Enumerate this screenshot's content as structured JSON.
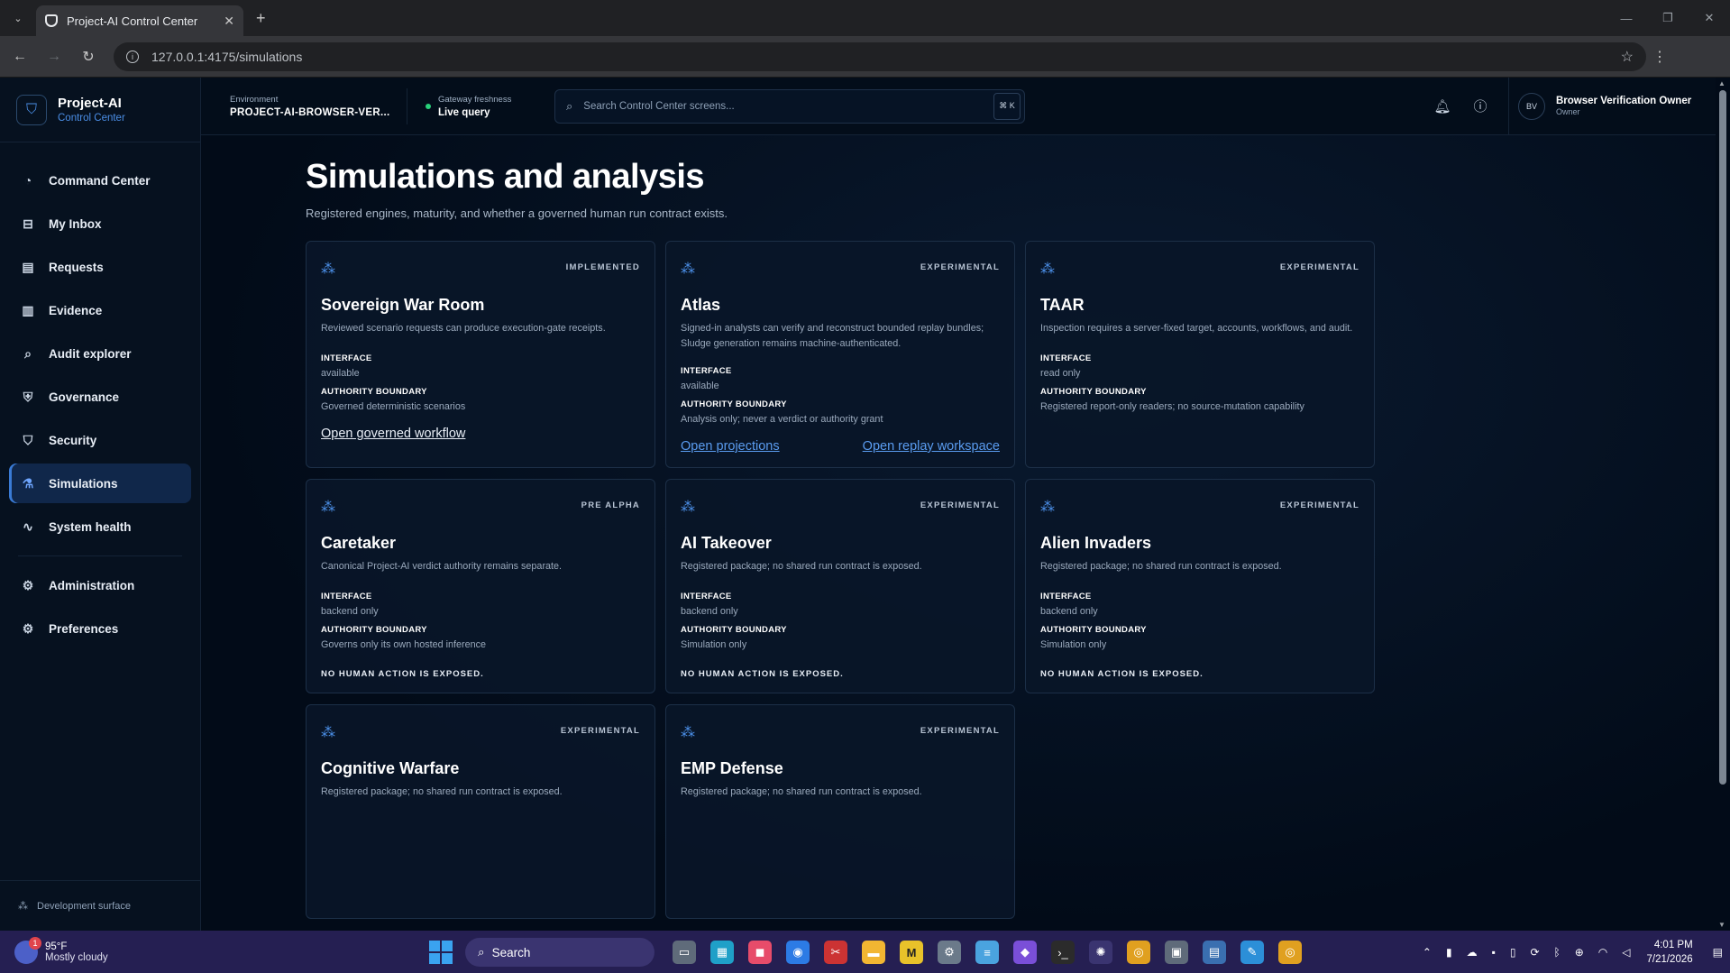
{
  "browser": {
    "tab_title": "Project-AI Control Center",
    "url": "127.0.0.1:4175/simulations"
  },
  "brand": {
    "name": "Project-AI",
    "subtitle": "Control Center"
  },
  "sidebar": {
    "items": [
      {
        "label": "Command Center",
        "icon": "speedometer-icon"
      },
      {
        "label": "My Inbox",
        "icon": "inbox-icon"
      },
      {
        "label": "Requests",
        "icon": "clipboard-icon"
      },
      {
        "label": "Evidence",
        "icon": "book-icon"
      },
      {
        "label": "Audit explorer",
        "icon": "magnifier-icon"
      },
      {
        "label": "Governance",
        "icon": "shield-check-icon"
      },
      {
        "label": "Security",
        "icon": "shield-icon"
      },
      {
        "label": "Simulations",
        "icon": "flask-icon",
        "active": true
      },
      {
        "label": "System health",
        "icon": "pulse-icon"
      }
    ],
    "secondary": [
      {
        "label": "Administration",
        "icon": "gear-icon"
      },
      {
        "label": "Preferences",
        "icon": "gear-icon"
      }
    ],
    "footer": "Development surface"
  },
  "topbar": {
    "env_label": "Environment",
    "env_value": "PROJECT-AI-BROWSER-VER...",
    "freshness_label": "Gateway freshness",
    "freshness_value": "Live query",
    "search_placeholder": "Search Control Center screens...",
    "search_kbd": "⌘ K",
    "user_initials": "BV",
    "user_name": "Browser Verification Owner",
    "user_role": "Owner"
  },
  "page": {
    "title": "Simulations and analysis",
    "subtitle": "Registered engines, maturity, and whether a governed human run contract exists."
  },
  "labels": {
    "interface": "INTERFACE",
    "authority": "AUTHORITY BOUNDARY",
    "no_human": "NO HUMAN ACTION IS EXPOSED."
  },
  "cards": [
    {
      "name": "Sovereign War Room",
      "badge": "IMPLEMENTED",
      "desc": "Reviewed scenario requests can produce execution-gate receipts.",
      "interface": "available",
      "authority": "Governed deterministic scenarios",
      "links": [
        "Open governed workflow"
      ]
    },
    {
      "name": "Atlas",
      "badge": "EXPERIMENTAL",
      "desc": "Signed-in analysts can verify and reconstruct bounded replay bundles; Sludge generation remains machine-authenticated.",
      "interface": "available",
      "authority": "Analysis only; never a verdict or authority grant",
      "links": [
        "Open projections",
        "Open replay workspace"
      ]
    },
    {
      "name": "TAAR",
      "badge": "EXPERIMENTAL",
      "desc": "Inspection requires a server-fixed target, accounts, workflows, and audit.",
      "interface": "read only",
      "authority": "Registered report-only readers; no source-mutation capability"
    },
    {
      "name": "Caretaker",
      "badge": "PRE ALPHA",
      "desc": "Canonical Project-AI verdict authority remains separate.",
      "interface": "backend only",
      "authority": "Governs only its own hosted inference"
    },
    {
      "name": "AI Takeover",
      "badge": "EXPERIMENTAL",
      "desc": "Registered package; no shared run contract is exposed.",
      "interface": "backend only",
      "authority": "Simulation only"
    },
    {
      "name": "Alien Invaders",
      "badge": "EXPERIMENTAL",
      "desc": "Registered package; no shared run contract is exposed.",
      "interface": "backend only",
      "authority": "Simulation only"
    },
    {
      "name": "Cognitive Warfare",
      "badge": "EXPERIMENTAL",
      "desc": "Registered package; no shared run contract is exposed."
    },
    {
      "name": "EMP Defense",
      "badge": "EXPERIMENTAL",
      "desc": "Registered package; no shared run contract is exposed."
    }
  ],
  "taskbar": {
    "temp": "95°F",
    "weather": "Mostly cloudy",
    "weather_badge": "1",
    "search": "Search",
    "time": "4:01 PM",
    "date": "7/21/2026"
  },
  "colors": {
    "accent": "#4b8ee6",
    "bg": "#020b18",
    "active_nav": "#10274a",
    "link": "#5a9cf0"
  }
}
